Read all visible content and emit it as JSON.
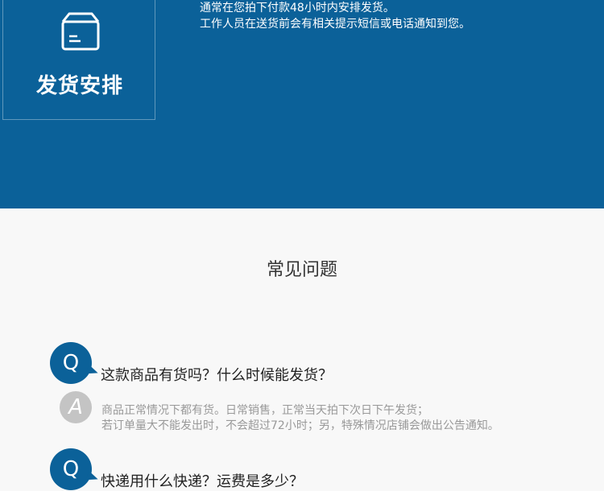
{
  "shipping": {
    "title": "发货安排",
    "icon": "package-box-icon",
    "notice_lines": [
      "通常在您拍下付款48小时内安排发货。",
      "工作人员在送货前会有相关提示短信或电话通知到您。"
    ]
  },
  "faq": {
    "title": "常见问题",
    "items": [
      {
        "q_label": "Q",
        "question": "这款商品有货吗？什么时候能发货？",
        "a_label": "A",
        "answer_lines": [
          "商品正常情况下都有货。日常销售，正常当天拍下次日下午发货；",
          "若订单量大不能发出时，不会超过72小时；另，特殊情况店铺会做出公告通知。"
        ]
      },
      {
        "q_label": "Q",
        "question": "快递用什么快递？运费是多少？"
      }
    ]
  },
  "colors": {
    "brand_blue": "#0b6199",
    "answer_gray": "#999999"
  }
}
